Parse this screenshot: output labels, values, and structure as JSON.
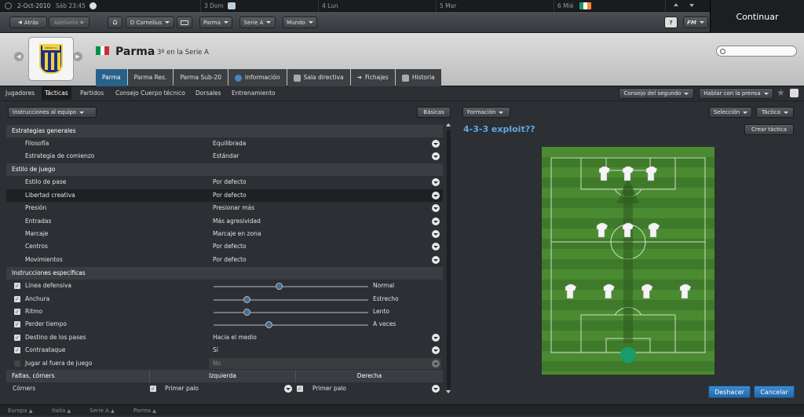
{
  "topbar": {
    "date": "2-Oct-2010",
    "time": "Sáb 23:45",
    "days": [
      "3 Dom",
      "4 Lun",
      "5 Mar",
      "6 Mié"
    ],
    "continue_label": "Continuar"
  },
  "nav": {
    "back_label": "Atrás",
    "forward_label": "Adelante",
    "manager_label": "D Cornelius",
    "club_label": "Parma",
    "league_label": "Serie A",
    "world_label": "Mundo",
    "help_label": "?",
    "fm_label": "FM"
  },
  "header": {
    "team_name": "Parma",
    "team_position": "3º en la Serie A",
    "crest_text": "PARMA F.C.",
    "search_placeholder": ""
  },
  "tabs": [
    {
      "label": "Parma",
      "active": true
    },
    {
      "label": "Parma Res."
    },
    {
      "label": "Parma Sub-20"
    },
    {
      "label": "Información"
    },
    {
      "label": "Sala directiva"
    },
    {
      "label": "Fichajes"
    },
    {
      "label": "Historia"
    }
  ],
  "subnav": {
    "items": [
      "Jugadores",
      "Tácticas",
      "Partidos",
      "Consejo Cuerpo técnico",
      "Dorsales",
      "Entrenamiento"
    ],
    "active_index": 1,
    "assistant_advice": "Consejo del segundo",
    "press": "Hablar con la prensa"
  },
  "left_panel": {
    "dropdown_label": "Instrucciones al equipo",
    "basics_button": "Básicas",
    "sections": {
      "general": "Estrategias generales",
      "style": "Estilo de juego",
      "specific": "Instrucciones específicas",
      "setpieces": "Faltas, córners"
    },
    "general_rows": [
      {
        "label": "Filosofía",
        "value": "Equilibrada"
      },
      {
        "label": "Estrategia de comienzo",
        "value": "Estándar"
      }
    ],
    "style_rows": [
      {
        "label": "Estilo de pase",
        "value": "Por defecto"
      },
      {
        "label": "Libertad creativa",
        "value": "Por defecto"
      },
      {
        "label": "Presión",
        "value": "Presionar más"
      },
      {
        "label": "Entradas",
        "value": "Más agresividad"
      },
      {
        "label": "Marcaje",
        "value": "Marcaje en zona"
      },
      {
        "label": "Centros",
        "value": "Por defecto"
      },
      {
        "label": "Movimientos",
        "value": "Por defecto"
      }
    ],
    "specific_rows": [
      {
        "label": "Línea defensiva",
        "checked": true,
        "type": "slider",
        "level": 0.42,
        "value": "Normal"
      },
      {
        "label": "Anchura",
        "checked": true,
        "type": "slider",
        "level": 0.2,
        "value": "Estrecho"
      },
      {
        "label": "Ritmo",
        "checked": true,
        "type": "slider",
        "level": 0.2,
        "value": "Lento"
      },
      {
        "label": "Perder tiempo",
        "checked": true,
        "type": "slider",
        "level": 0.35,
        "value": "A veces"
      },
      {
        "label": "Destino de los pases",
        "checked": true,
        "type": "dropdown",
        "value": "Hacia el medio"
      },
      {
        "label": "Contraataque",
        "checked": true,
        "type": "dropdown",
        "value": "Sí"
      },
      {
        "label": "Jugar al fuera de juego",
        "checked": false,
        "type": "disabled",
        "value": "No"
      }
    ],
    "setpieces": {
      "left_header": "Izquierda",
      "right_header": "Derecha",
      "row_label": "Córners",
      "left_value": "Primer palo",
      "right_value": "Primer palo"
    }
  },
  "right_panel": {
    "formation_dropdown": "Formación",
    "selection_dropdown": "Selección",
    "tactic_dropdown": "Táctica",
    "tactic_name": "4-3-3 exploit??",
    "create_tactic": "Crear táctica",
    "undo": "Deshacer",
    "cancel": "Cancelar",
    "formation": {
      "forwards": 3,
      "midfielders": 3,
      "defenders": 4,
      "goalkeeper": 1
    },
    "colors": {
      "pitch": "#3f7a2a",
      "pitch_stripe": "#4a8a31",
      "keeper": "#1a9b6c",
      "accent": "#2f7dc5"
    }
  },
  "bottombar": [
    "Europa",
    "Italia",
    "Serie A",
    "Parma"
  ]
}
